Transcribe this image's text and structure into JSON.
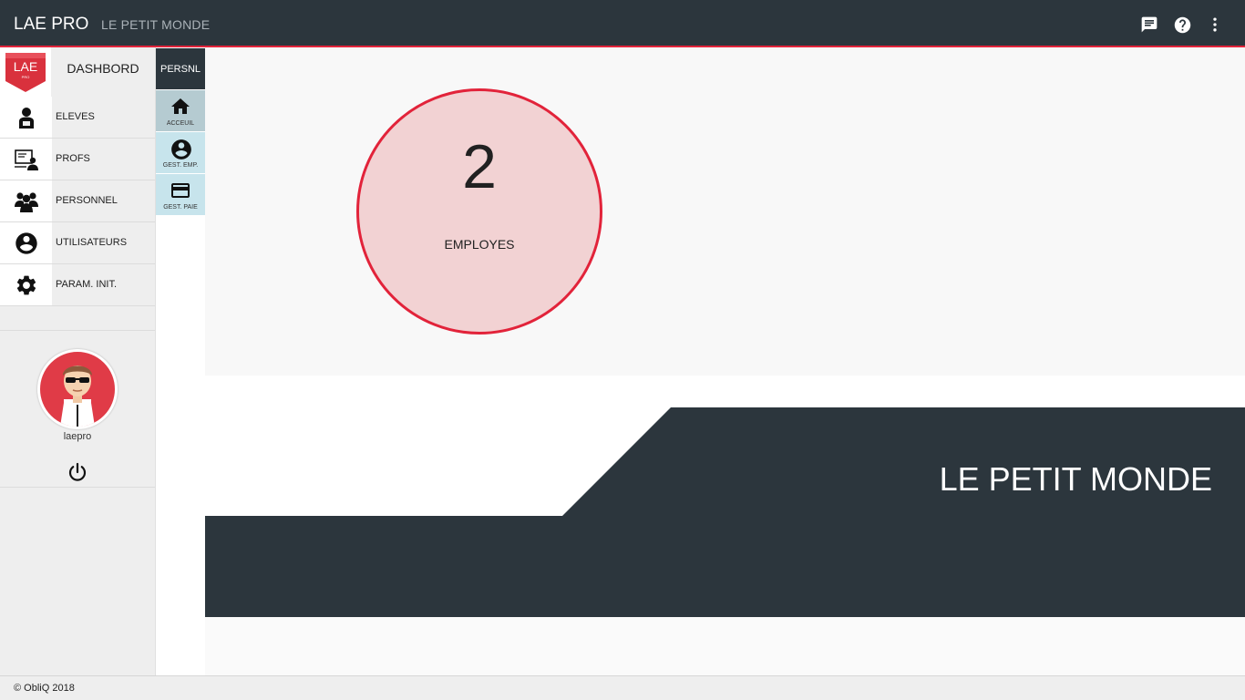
{
  "header": {
    "app_title": "LAE PRO",
    "subtitle": "LE PETIT MONDE",
    "icons": [
      "chat-icon",
      "help-icon",
      "more-vert-icon"
    ]
  },
  "sidebar": {
    "logo_text": "LAE",
    "dashboard_label": "DASHBORD",
    "items": [
      {
        "label": "ELEVES",
        "icon": "student-icon"
      },
      {
        "label": "PROFS",
        "icon": "teacher-icon"
      },
      {
        "label": "PERSONNEL",
        "icon": "group-icon"
      },
      {
        "label": "UTILISATEURS",
        "icon": "account-icon"
      },
      {
        "label": "PARAM. INIT.",
        "icon": "gear-icon"
      }
    ],
    "username": "laepro"
  },
  "rail": {
    "header": "PERSNL",
    "items": [
      {
        "label": "ACCEUIL",
        "icon": "home-icon"
      },
      {
        "label": "GEST. EMP.",
        "icon": "person-icon"
      },
      {
        "label": "GEST. PAIE",
        "icon": "credit-card-icon"
      }
    ]
  },
  "main": {
    "stat": {
      "value": "2",
      "label": "EMPLOYES"
    },
    "banner_title": "LE PETIT MONDE"
  },
  "footer": {
    "copyright": "© ObliQ 2018"
  },
  "colors": {
    "dark": "#2c363d",
    "accent": "#e2233a",
    "circle_fill": "#f2d2d3",
    "rail_active": "#b5cbd1",
    "rail_item": "#c7e4ec"
  }
}
